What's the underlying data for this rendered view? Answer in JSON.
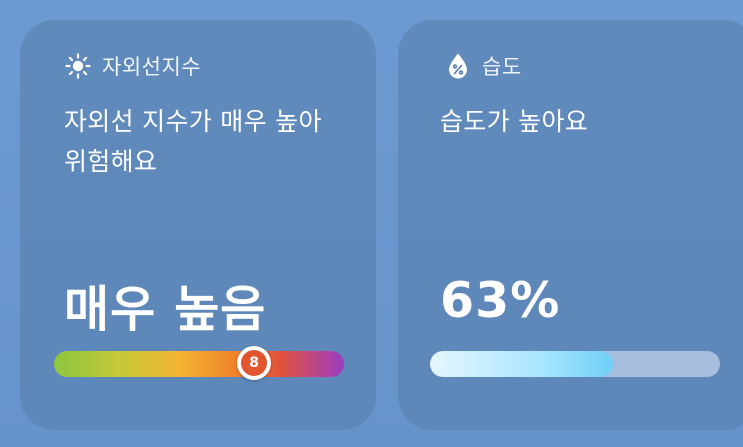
{
  "uv_card": {
    "title": "자외선지수",
    "icon": "sun-icon",
    "description": "자외선 지수가 매우 높아 위험해요",
    "level_text": "매우 높음",
    "index_value": "8",
    "index_fraction": 0.69,
    "gradient_colors": [
      "#8dc63f",
      "#f2b633",
      "#f08a2a",
      "#e0523a",
      "#9a3dbf"
    ]
  },
  "humidity_card": {
    "title": "습도",
    "icon": "droplet-percent-icon",
    "description": "습도가 높아요",
    "value_text": "63%",
    "fill_fraction": 0.63,
    "fill_color": "#a9e6ff"
  },
  "colors": {
    "background": "#6a98cf",
    "card": "#587dac",
    "text": "#ffffff"
  }
}
